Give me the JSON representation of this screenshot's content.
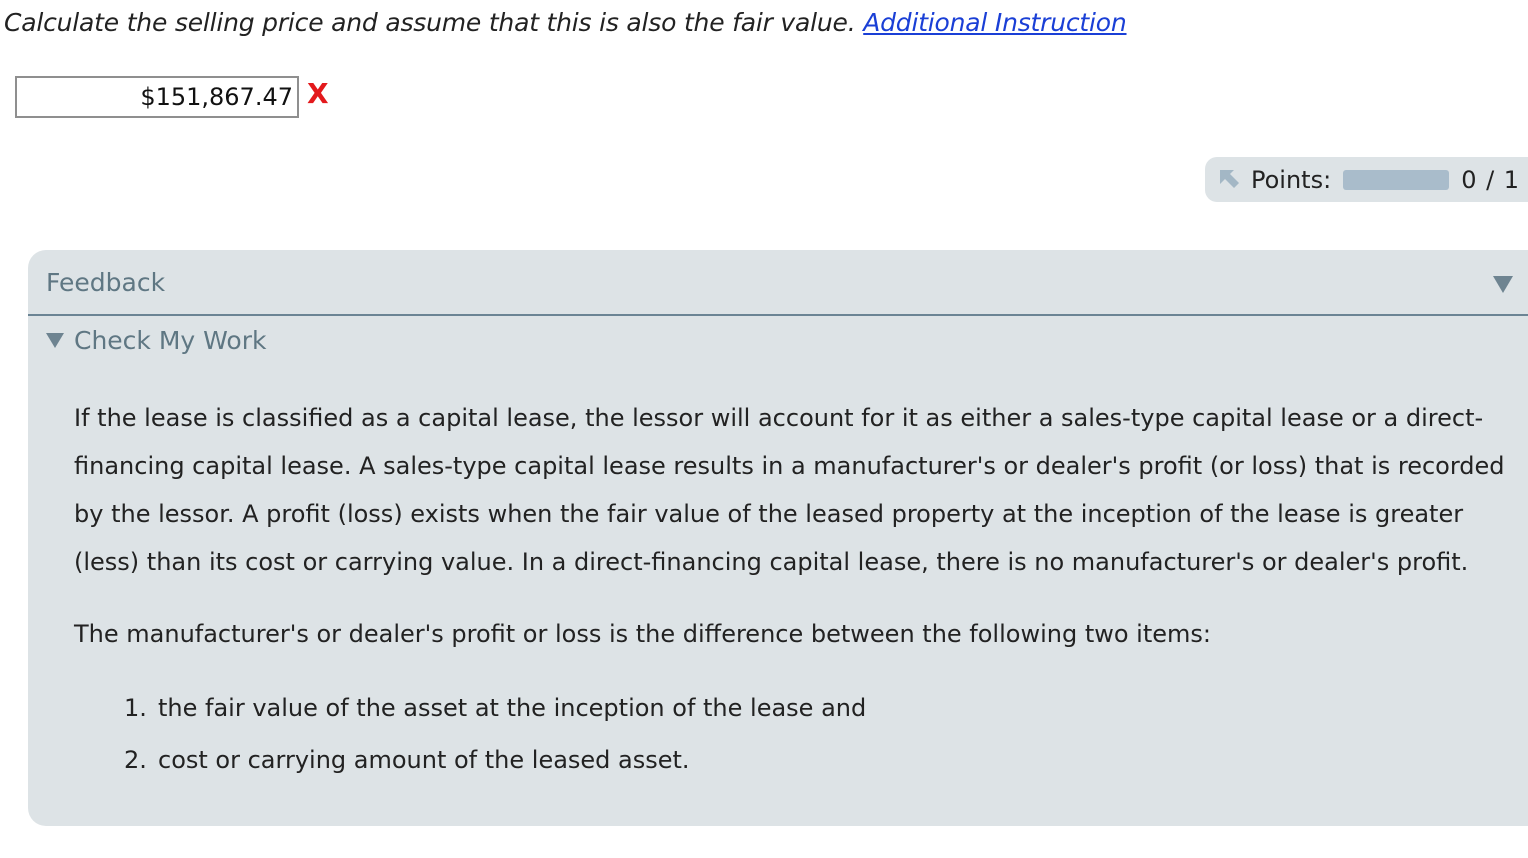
{
  "question": {
    "text": "Calculate the selling price and assume that this is also the fair value.",
    "link_label": "Additional Instruction"
  },
  "answer": {
    "value": "$151,867.47",
    "status_mark": "X"
  },
  "points": {
    "label": "Points:",
    "score": "0 / 1"
  },
  "feedback": {
    "title": "Feedback",
    "section_label": "Check My Work",
    "paragraph1": "If the lease is classified as a capital lease, the lessor will account for it as either a sales-type capital lease or a direct-financing capital lease. A sales-type capital lease results in a manufacturer's or dealer's profit (or loss) that is recorded by the lessor. A profit (loss) exists when the fair value of the leased property at the inception of the lease is greater (less) than its cost or carrying value. In a direct-financing capital lease, there is no manufacturer's or dealer's profit.",
    "paragraph2": "The manufacturer's or dealer's profit or loss is the difference between the following two items:",
    "items": [
      {
        "number": "1.",
        "text": "the fair value of the asset at the inception of the lease and"
      },
      {
        "number": "2.",
        "text": "cost or carrying amount of the leased asset."
      }
    ]
  },
  "colors": {
    "link": "#1a3fd6",
    "error": "#e3191c",
    "panel_bg": "#dde3e6",
    "panel_header_text": "#5f7783",
    "points_bar": "#a9bccb"
  }
}
